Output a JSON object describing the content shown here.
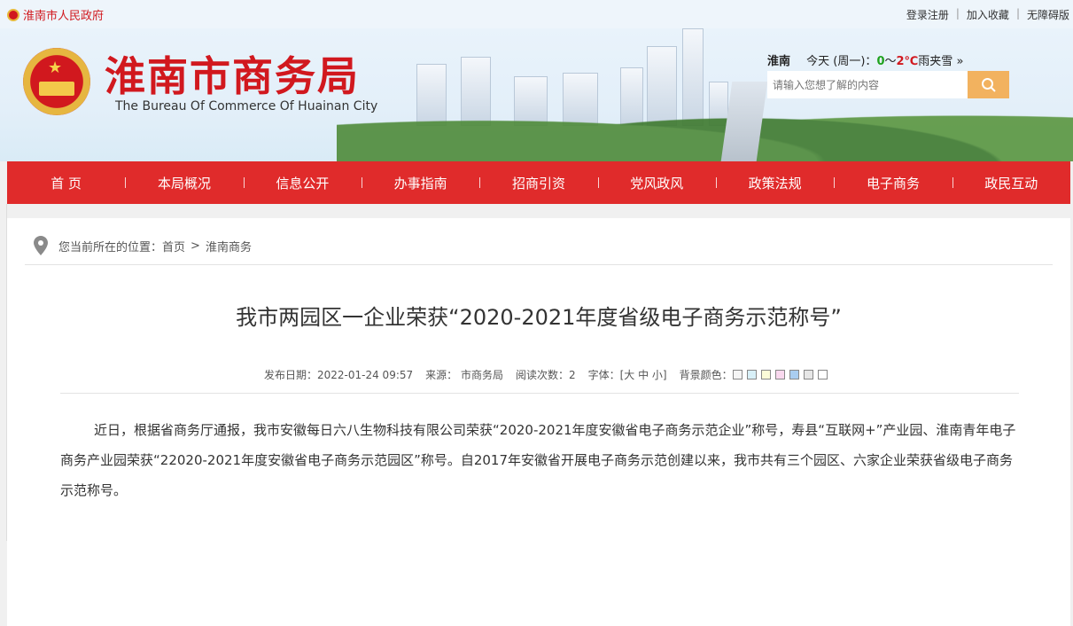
{
  "topbar": {
    "gov_link": "淮南市人民政府",
    "links": [
      "登录注册",
      "加入收藏",
      "无障碍版"
    ]
  },
  "header": {
    "title": "淮南市商务局",
    "subtitle": "The Bureau Of Commerce Of Huainan City",
    "weather": {
      "city": "淮南",
      "today": "今天 (周一)：",
      "low": "0",
      "range_sep": "～",
      "high": "2℃",
      "condition": "雨夹雪",
      "more": "»"
    },
    "search": {
      "placeholder": "请输入您想了解的内容",
      "icon": "search-icon"
    }
  },
  "nav": {
    "items": [
      "首  页",
      "本局概况",
      "信息公开",
      "办事指南",
      "招商引资",
      "党风政风",
      "政策法规",
      "电子商务",
      "政民互动"
    ]
  },
  "breadcrumb": {
    "prefix": "您当前所在的位置：",
    "home": "首页",
    "sep": ">",
    "current": "淮南商务",
    "icon": "location-pin-icon"
  },
  "article": {
    "title": "我市两园区一企业荣获“2020-2021年度省级电子商务示范称号”",
    "meta": {
      "date": "发布日期：2022-01-24 09:57",
      "source": "来源：  市商务局",
      "views": "阅读次数：2",
      "font": "字体：[大 中 小]",
      "bg_label": "背景颜色："
    },
    "bg_swatches": [
      "#f5f5f5",
      "#d8f0f8",
      "#fbfbd8",
      "#f9d8ee",
      "#a9cdf0",
      "#e6e6e6",
      "#ffffff"
    ],
    "body": "近日，根据省商务厅通报，我市安徽每日六八生物科技有限公司荣获“2020-2021年度安徽省电子商务示范企业”称号，寿县“互联网+”产业园、淮南青年电子商务产业园荣获“22020-2021年度安徽省电子商务示范园区”称号。自2017年安徽省开展电子商务示范创建以来，我市共有三个园区、六家企业荣获省级电子商务示范称号。"
  },
  "colors": {
    "brand_red": "#d1181e",
    "nav_red": "#e02b2b",
    "search_btn": "#f2b25f"
  }
}
